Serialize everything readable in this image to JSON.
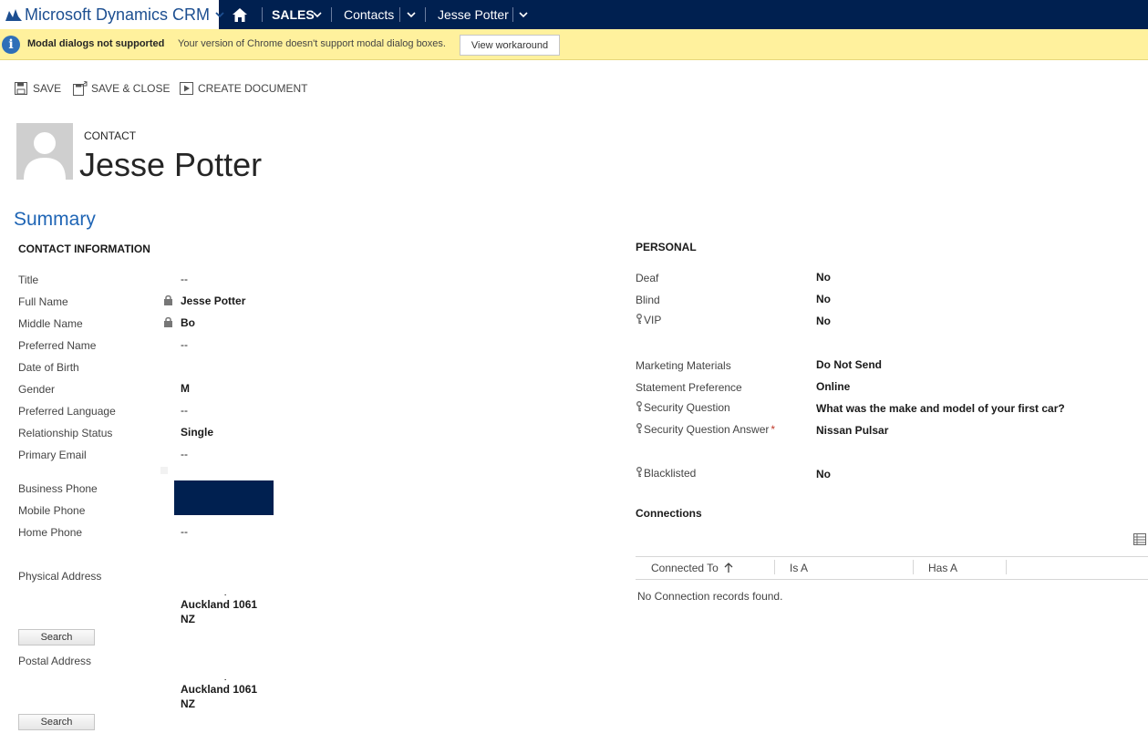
{
  "nav": {
    "app_title": "Microsoft Dynamics CRM",
    "area": "SALES",
    "entity": "Contacts",
    "record": "Jesse Potter"
  },
  "notification": {
    "title": "Modal dialogs not supported",
    "message": "Your version of Chrome doesn't support modal dialog boxes.",
    "button": "View workaround"
  },
  "commands": {
    "save": "SAVE",
    "save_close": "SAVE & CLOSE",
    "create_document": "CREATE DOCUMENT"
  },
  "header": {
    "entity_type": "CONTACT",
    "name": "Jesse Potter"
  },
  "summary_title": "Summary",
  "contact_info": {
    "heading": "CONTACT INFORMATION",
    "fields": {
      "title": {
        "label": "Title",
        "value": "--"
      },
      "full_name": {
        "label": "Full Name",
        "value": "Jesse Potter"
      },
      "middle_name": {
        "label": "Middle Name",
        "value": "Bo"
      },
      "preferred_name": {
        "label": "Preferred Name",
        "value": "--"
      },
      "dob": {
        "label": "Date of Birth",
        "value": ""
      },
      "gender": {
        "label": "Gender",
        "value": "M"
      },
      "language": {
        "label": "Preferred Language",
        "value": "--"
      },
      "relationship": {
        "label": "Relationship Status",
        "value": "Single"
      },
      "email": {
        "label": "Primary Email",
        "value": "--"
      },
      "business_phone": {
        "label": "Business Phone",
        "value": ""
      },
      "mobile_phone": {
        "label": "Mobile Phone",
        "value": ""
      },
      "home_phone": {
        "label": "Home Phone",
        "value": "--"
      }
    },
    "physical_address": {
      "label": "Physical Address",
      "line1": "Auckland 1061",
      "line2": "NZ",
      "search_label": "Search"
    },
    "postal_address": {
      "label": "Postal Address",
      "line1": "Auckland 1061",
      "line2": "NZ",
      "search_label": "Search"
    }
  },
  "personal": {
    "heading": "PERSONAL",
    "fields": {
      "deaf": {
        "label": "Deaf",
        "value": "No"
      },
      "blind": {
        "label": "Blind",
        "value": "No"
      },
      "vip": {
        "label": "VIP",
        "value": "No"
      },
      "marketing": {
        "label": "Marketing Materials",
        "value": "Do Not Send"
      },
      "statement": {
        "label": "Statement Preference",
        "value": "Online"
      },
      "sec_question": {
        "label": "Security Question",
        "value": "What was the make and model of your first car?"
      },
      "sec_answer": {
        "label": "Security Question Answer",
        "value": "Nissan Pulsar",
        "required_mark": "*"
      },
      "blacklisted": {
        "label": "Blacklisted",
        "value": "No"
      }
    }
  },
  "connections": {
    "heading": "Connections",
    "columns": [
      "Connected To",
      "Is A",
      "Has A"
    ],
    "empty_message": "No Connection records found."
  },
  "colors": {
    "navbar": "#002050",
    "notification": "#fff19d",
    "accent": "#1f65b5"
  }
}
